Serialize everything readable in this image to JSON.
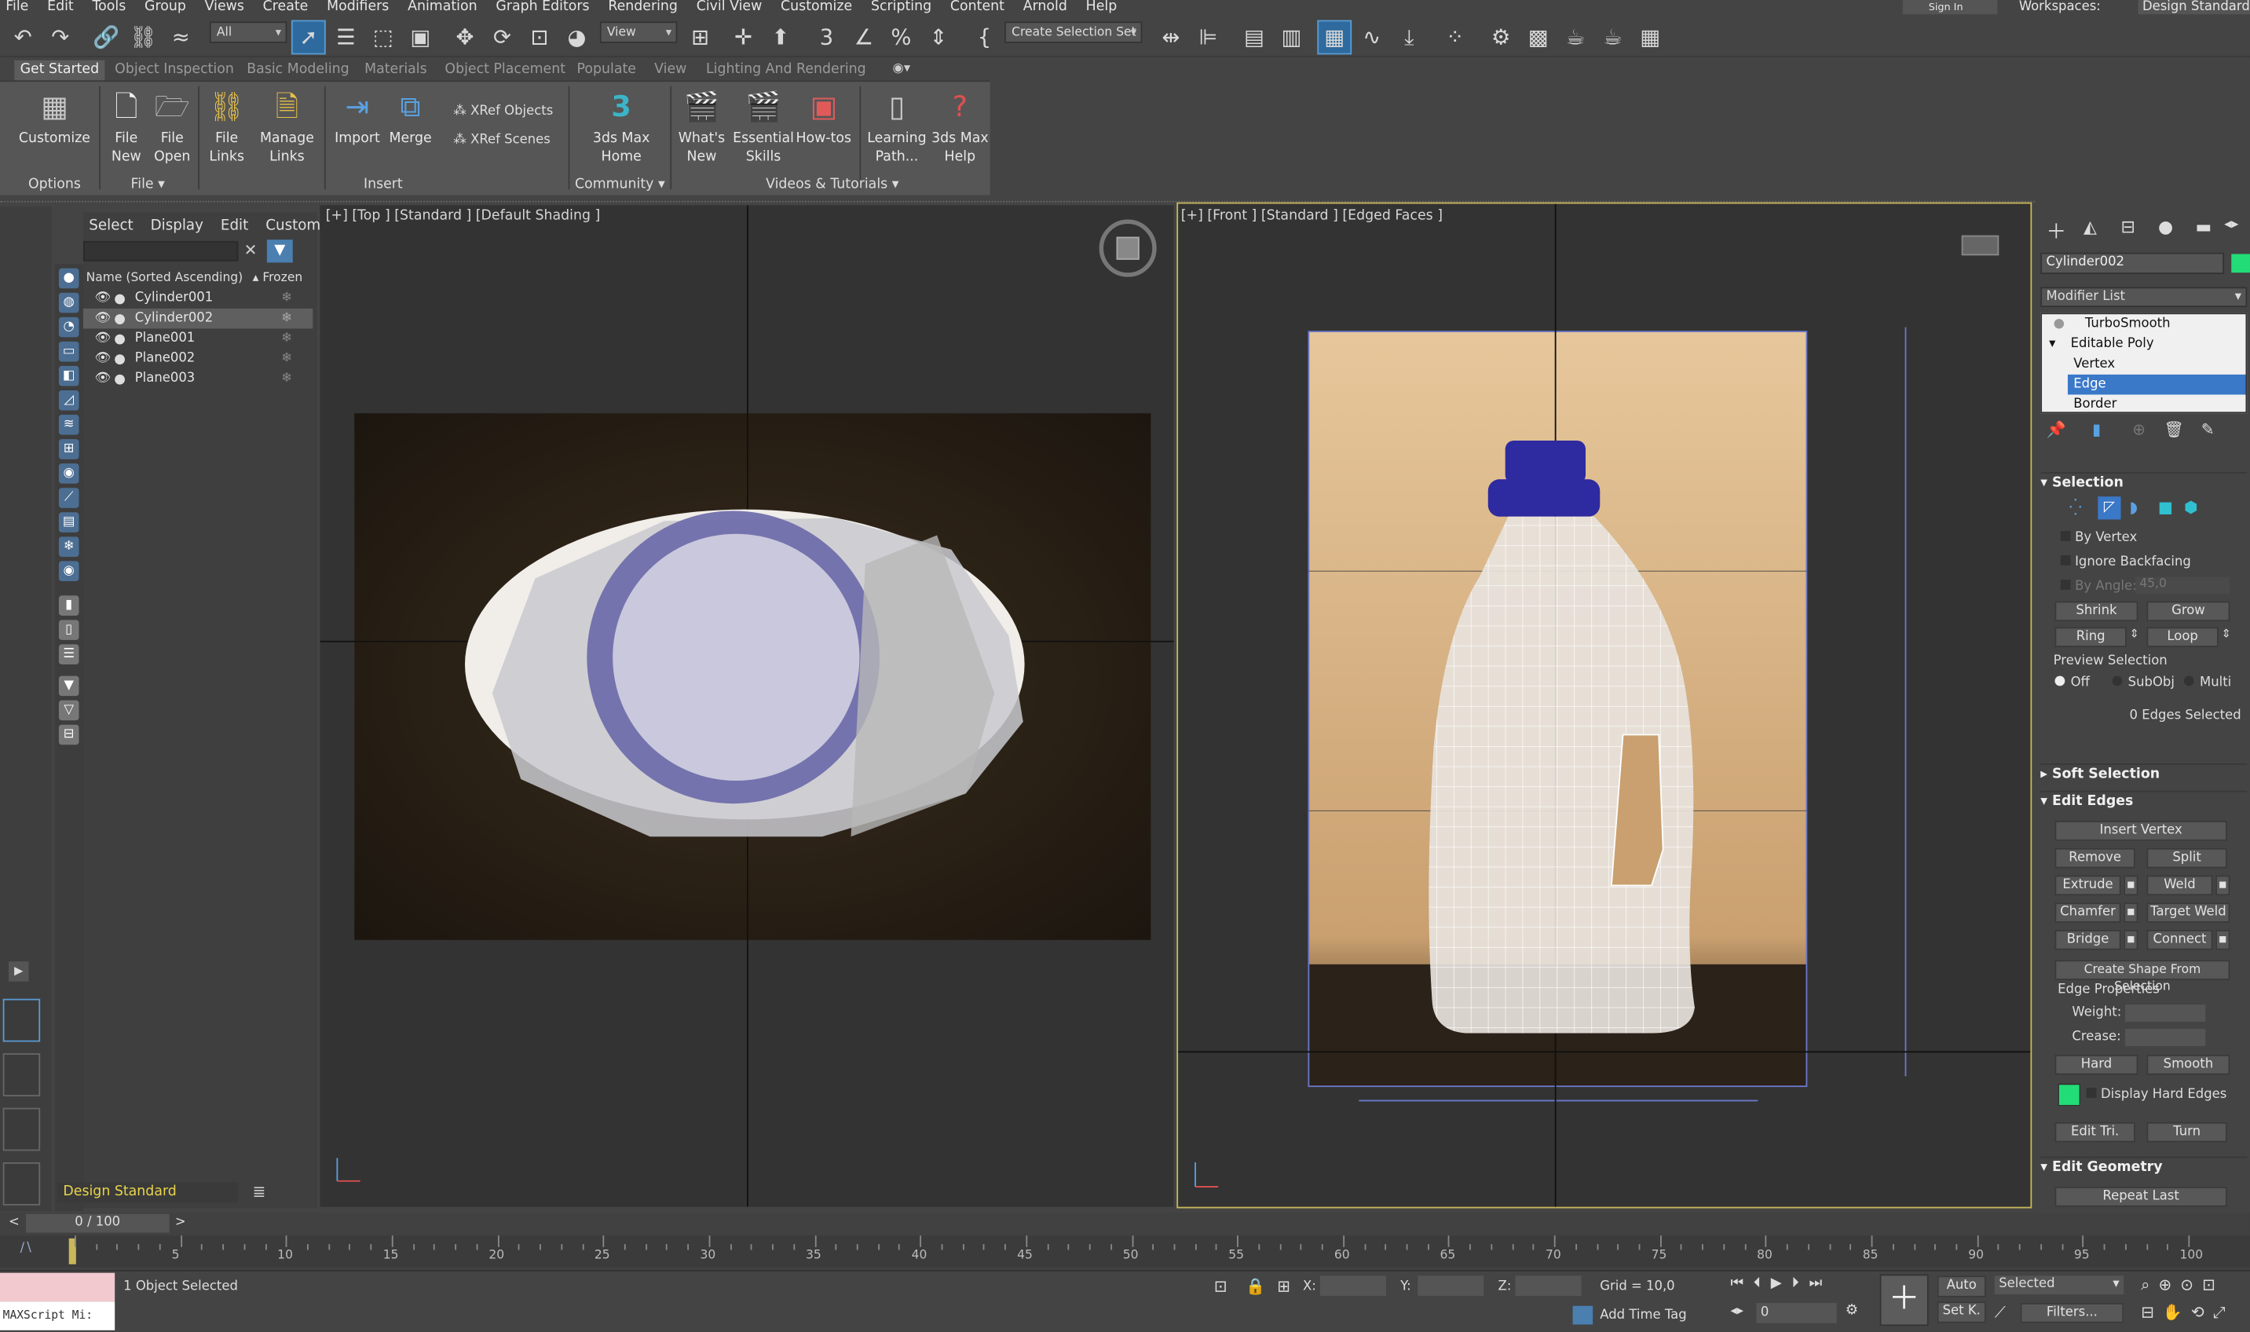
{
  "menus": [
    "File",
    "Edit",
    "Tools",
    "Group",
    "Views",
    "Create",
    "Modifiers",
    "Animation",
    "Graph Editors",
    "Rendering",
    "Civil View",
    "Customize",
    "Scripting",
    "Content",
    "Arnold",
    "Help"
  ],
  "account": {
    "sign_in": "Sign In",
    "workspaces_label": "Workspaces:",
    "workspace": "Design Standard"
  },
  "toolbar": {
    "filter": "All",
    "ref_coord": "View",
    "selection_set": "Create Selection Set"
  },
  "ribbon_tabs": [
    "Get Started",
    "Object Inspection",
    "Basic Modeling",
    "Materials",
    "Object Placement",
    "Populate",
    "View",
    "Lighting And Rendering"
  ],
  "ribbon": {
    "customize": "Customize",
    "file_new_1": "File",
    "file_new_2": "New",
    "file_open_1": "File",
    "file_open_2": "Open",
    "file_links_1": "File",
    "file_links_2": "Links",
    "manage_links_1": "Manage",
    "manage_links_2": "Links",
    "import": "Import",
    "merge": "Merge",
    "xref_objects": "XRef Objects",
    "xref_scenes": "XRef Scenes",
    "home_1": "3ds Max",
    "home_2": "Home",
    "whats_new_1": "What's",
    "whats_new_2": "New",
    "essential_1": "Essential",
    "essential_2": "Skills",
    "howtos": "How-tos",
    "learning_1": "Learning",
    "learning_2": "Path...",
    "help_1": "3ds Max",
    "help_2": "Help",
    "groups": {
      "options": "Options",
      "file": "File",
      "insert": "Insert",
      "community": "Community",
      "videos": "Videos & Tutorials"
    }
  },
  "explorer": {
    "tabs": [
      "Select",
      "Display",
      "Edit",
      "Customize"
    ],
    "col_name": "Name (Sorted Ascending)",
    "col_frozen": "▴ Frozen",
    "items": [
      "Cylinder001",
      "Cylinder002",
      "Plane001",
      "Plane002",
      "Plane003"
    ],
    "workspace": "Design Standard"
  },
  "viewports": {
    "top_label": "[+] [Top ] [Standard ] [Default Shading ]",
    "front_label": "[+] [Front ] [Standard ] [Edged Faces ]"
  },
  "command_panel": {
    "object_name": "Cylinder002",
    "modifier_list": "Modifier List",
    "stack": [
      "TurboSmooth",
      "Editable Poly",
      "Vertex",
      "Edge",
      "Border"
    ],
    "selection_title": "Selection",
    "by_vertex": "By Vertex",
    "ignore_backfacing": "Ignore Backfacing",
    "by_angle": "By Angle:",
    "angle_value": "45,0",
    "shrink": "Shrink",
    "grow": "Grow",
    "ring": "Ring",
    "loop": "Loop",
    "preview_selection": "Preview Selection",
    "preview_off": "Off",
    "preview_subobj": "SubObj",
    "preview_multi": "Multi",
    "edges_selected": "0 Edges Selected",
    "soft_selection": "Soft Selection",
    "edit_edges": "Edit Edges",
    "insert_vertex": "Insert Vertex",
    "remove": "Remove",
    "split": "Split",
    "extrude": "Extrude",
    "weld": "Weld",
    "chamfer": "Chamfer",
    "target_weld": "Target Weld",
    "bridge": "Bridge",
    "connect": "Connect",
    "create_shape": "Create Shape From Selection",
    "edge_properties": "Edge Properties",
    "weight": "Weight:",
    "crease": "Crease:",
    "hard": "Hard",
    "smooth": "Smooth",
    "display_hard_edges": "Display Hard Edges",
    "edit_tri": "Edit Tri.",
    "turn": "Turn",
    "edit_geometry": "Edit Geometry",
    "repeat_last": "Repeat Last"
  },
  "timeline": {
    "frame": "0 / 100",
    "ticks": [
      "5",
      "10",
      "15",
      "20",
      "25",
      "30",
      "35",
      "40",
      "45",
      "50",
      "55",
      "60",
      "65",
      "70",
      "75",
      "80",
      "85",
      "90",
      "95",
      "100"
    ]
  },
  "status": {
    "maxscript": "MAXScript Mi:",
    "selected": "1 Object Selected",
    "x_label": "X:",
    "y_label": "Y:",
    "z_label": "Z:",
    "grid": "Grid = 10,0",
    "add_time_tag": "Add Time Tag",
    "auto": "Auto",
    "set_key": "Set K.",
    "key_mode": "Selected",
    "frame_field": "0",
    "filters": "Filters..."
  },
  "colors": {
    "accent": "#2f6a9e",
    "object_color": "#22dd77",
    "viewport_border": "#c9b75a",
    "workspace_text": "#e8d44d"
  }
}
